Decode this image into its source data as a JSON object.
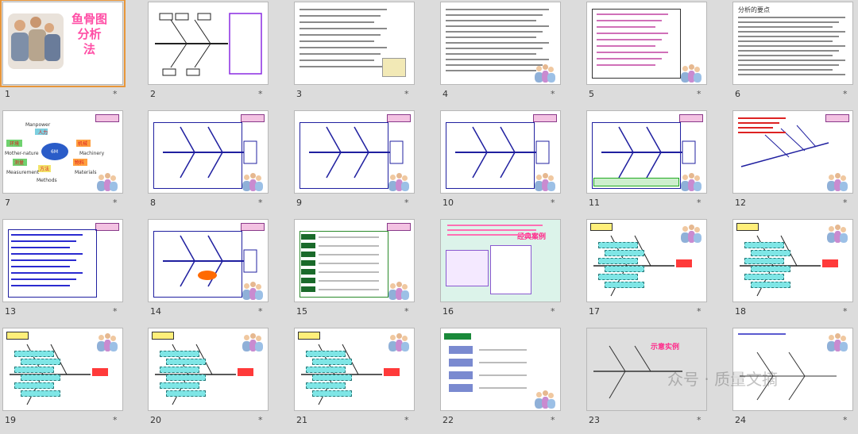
{
  "slides": [
    {
      "num": "1",
      "title": "鱼骨图\n分析\n法"
    },
    {
      "num": "2"
    },
    {
      "num": "3"
    },
    {
      "num": "4"
    },
    {
      "num": "5"
    },
    {
      "num": "6",
      "title": "分析的要点"
    },
    {
      "num": "7",
      "labels": [
        "Manpower",
        "人力",
        "环境",
        "Mother-nature",
        "6M",
        "机械",
        "Machinery",
        "方法",
        "Methods",
        "物料",
        "Materials",
        "测量",
        "Measurement"
      ]
    },
    {
      "num": "8"
    },
    {
      "num": "9"
    },
    {
      "num": "10"
    },
    {
      "num": "11"
    },
    {
      "num": "12"
    },
    {
      "num": "13"
    },
    {
      "num": "14"
    },
    {
      "num": "15"
    },
    {
      "num": "16",
      "title": "经典案例"
    },
    {
      "num": "17"
    },
    {
      "num": "18"
    },
    {
      "num": "19"
    },
    {
      "num": "20"
    },
    {
      "num": "21"
    },
    {
      "num": "22"
    },
    {
      "num": "23",
      "title": "示意实例"
    },
    {
      "num": "24"
    }
  ],
  "star": "*",
  "watermark": "众号 · 质量文摘"
}
